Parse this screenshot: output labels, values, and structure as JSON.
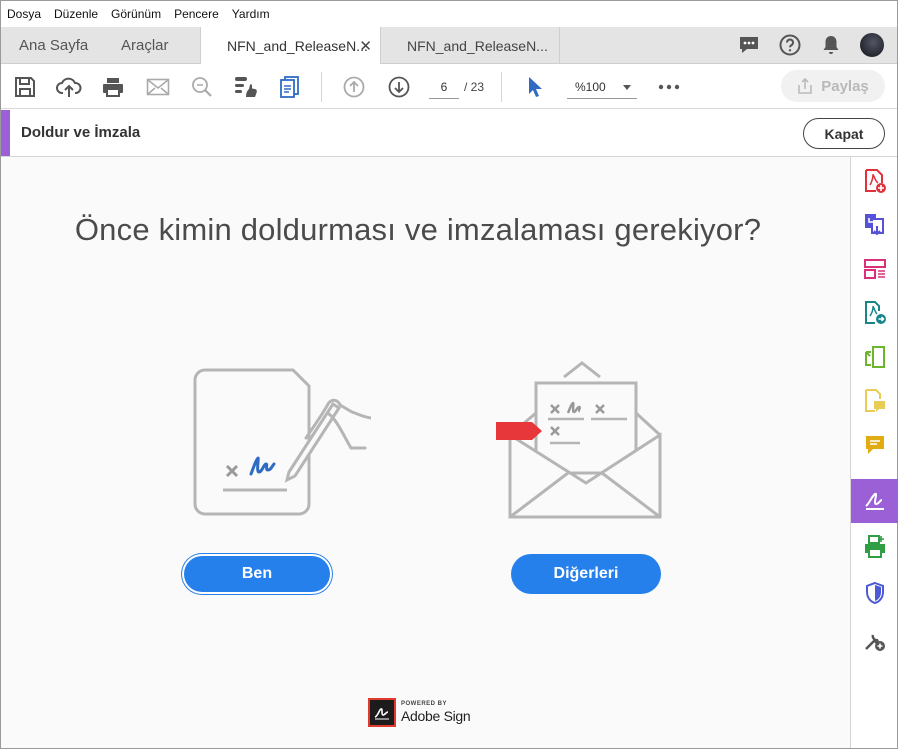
{
  "menu": [
    "Dosya",
    "Düzenle",
    "Görünüm",
    "Pencere",
    "Yardım"
  ],
  "tabs": {
    "home": "Ana Sayfa",
    "tools": "Araçlar",
    "doc_active": "NFN_and_ReleaseN...",
    "doc_other": "NFN_and_ReleaseN...",
    "close_glyph": "✕"
  },
  "toolbar": {
    "current_page": "6",
    "page_separator": "/ 23",
    "zoom": "%100",
    "share_label": "Paylaş"
  },
  "panel": {
    "title": "Doldur ve İmzala",
    "close_label": "Kapat"
  },
  "main": {
    "question": "Önce kimin doldurması ve imzalaması gerekiyor?",
    "me_label": "Ben",
    "others_label": "Diğerleri"
  },
  "branding": {
    "powered_by": "POWERED BY",
    "product": "Adobe Sign"
  },
  "colors": {
    "accent_blue": "#2680eb",
    "fill_sign_purple": "#9b5fd6",
    "flag_red": "#e8373b"
  },
  "right_tools": [
    "create-pdf-icon",
    "combine-files-icon",
    "organize-pages-icon",
    "export-pdf-icon",
    "edit-pdf-icon",
    "send-for-comments-icon",
    "comment-icon",
    "fill-sign-icon",
    "print-production-icon",
    "protect-icon",
    "more-tools-icon"
  ]
}
